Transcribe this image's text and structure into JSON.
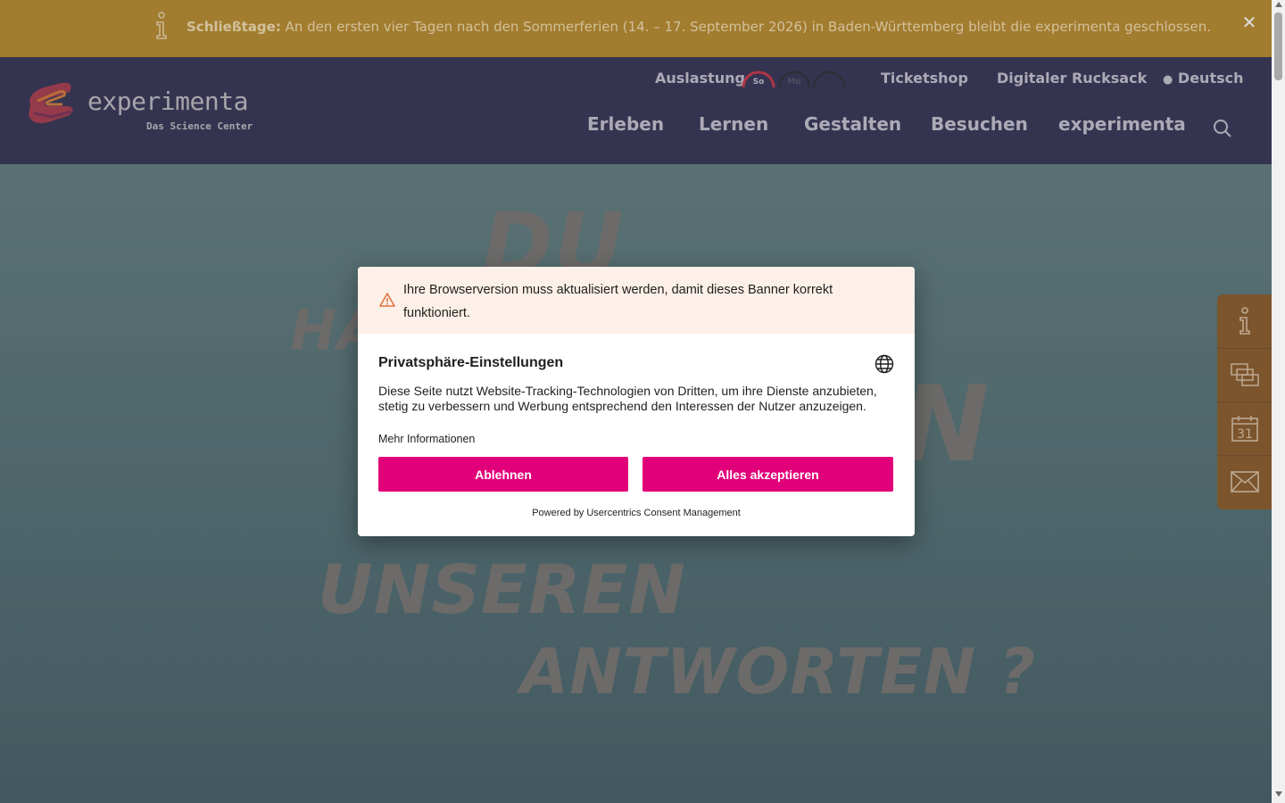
{
  "notice": {
    "label": "Schließtage:",
    "text": "An den ersten vier Tagen nach den Sommerferien (14. – 17. September 2026) in Baden-Württemberg bleibt die experimenta geschlossen.",
    "close": "✕"
  },
  "logo": {
    "name": "experimenta",
    "tagline": "Das Science Center"
  },
  "utility_nav": {
    "occupancy_label": "Auslastung",
    "gauges": [
      "So",
      "Mo",
      ""
    ],
    "ticketshop": "Ticketshop",
    "backpack": "Digitaler Rucksack",
    "language": "Deutsch"
  },
  "main_nav": [
    "Erleben",
    "Lernen",
    "Gestalten",
    "Besuchen",
    "experimenta"
  ],
  "hero": {
    "words": [
      "DU",
      "HA",
      "N",
      "UNSEREN",
      "ANTWORTEN ?"
    ]
  },
  "side_tools": [
    "info-icon",
    "tickets-icon",
    "calendar-icon",
    "mail-icon"
  ],
  "side_calendar_day": "31",
  "consent": {
    "warning": "Ihre Browserversion muss aktualisiert werden, damit dieses Banner korrekt funktioniert.",
    "title": "Privatsphäre-Einstellungen",
    "description": "Diese Seite nutzt Website-Tracking-Technologien von Dritten, um ihre Dienste anzubieten, stetig zu verbessern und Werbung entsprechend den Interessen der Nutzer anzuzeigen.",
    "more_info": "Mehr Informationen",
    "deny": "Ablehnen",
    "accept": "Alles akzeptieren",
    "powered": "Powered by Usercentrics Consent Management"
  },
  "colors": {
    "accent": "#e2007a",
    "header": "#343255",
    "notice": "#b98a2c",
    "side_tools": "#8a5b2a"
  }
}
